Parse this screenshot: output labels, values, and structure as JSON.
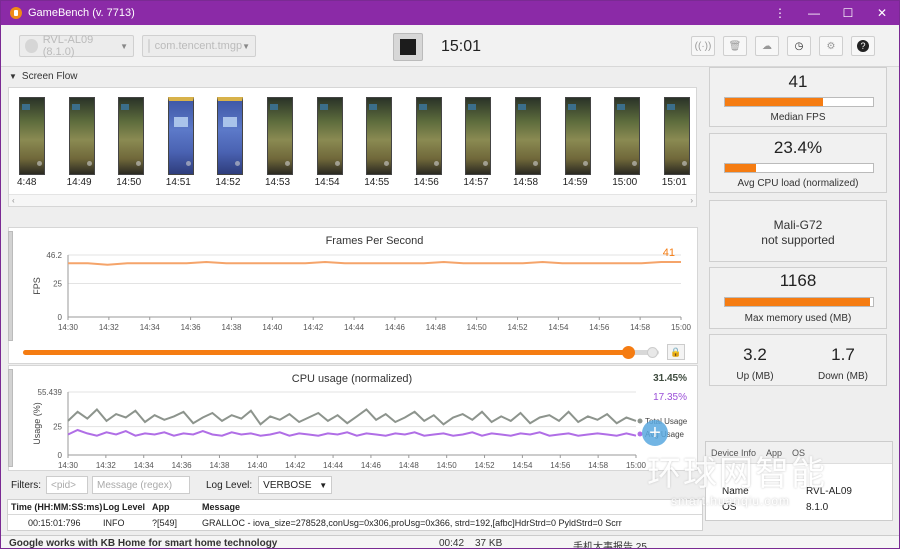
{
  "window": {
    "title": "GameBench (v. 7713)"
  },
  "toolbar": {
    "device_placeholder": "RVL-AL09 (8.1.0)",
    "app_placeholder": "com.tencent.tmgp",
    "timer": "15:01"
  },
  "screen_flow": {
    "header": "Screen Flow",
    "thumbnails": [
      {
        "time": "4:48",
        "kind": "game"
      },
      {
        "time": "14:49",
        "kind": "game"
      },
      {
        "time": "14:50",
        "kind": "game"
      },
      {
        "time": "14:51",
        "kind": "map"
      },
      {
        "time": "14:52",
        "kind": "map"
      },
      {
        "time": "14:53",
        "kind": "game"
      },
      {
        "time": "14:54",
        "kind": "game"
      },
      {
        "time": "14:55",
        "kind": "game"
      },
      {
        "time": "14:56",
        "kind": "game"
      },
      {
        "time": "14:57",
        "kind": "game"
      },
      {
        "time": "14:58",
        "kind": "game"
      },
      {
        "time": "14:59",
        "kind": "game"
      },
      {
        "time": "15:00",
        "kind": "game"
      },
      {
        "time": "15:01",
        "kind": "game"
      }
    ]
  },
  "chart_data": [
    {
      "type": "line",
      "title": "Frames Per Second",
      "ylabel": "FPS",
      "ylim": [
        0,
        46.2
      ],
      "yticks": [
        "46.2",
        "25",
        "0"
      ],
      "yticks_values": [
        46.2,
        25,
        0
      ],
      "x_ticks": [
        "14:30",
        "14:32",
        "14:34",
        "14:36",
        "14:38",
        "14:40",
        "14:42",
        "14:44",
        "14:46",
        "14:48",
        "14:50",
        "14:52",
        "14:54",
        "14:56",
        "14:58",
        "15:00"
      ],
      "current_label": "41",
      "series": [
        {
          "color": "#f5a46a",
          "values": [
            40,
            40,
            39,
            40,
            40,
            40,
            40,
            41,
            40,
            40,
            40,
            40,
            40,
            41,
            40,
            40,
            40,
            40,
            40,
            41,
            40,
            40,
            40,
            40,
            41,
            40,
            40,
            40,
            40,
            40,
            41,
            41
          ]
        }
      ]
    },
    {
      "type": "line",
      "title": "CPU usage (normalized)",
      "ylabel": "Usage (%)",
      "ylim": [
        0,
        55.439
      ],
      "yticks": [
        "55.439",
        "25",
        "0"
      ],
      "yticks_values": [
        55.439,
        25,
        0
      ],
      "x_ticks": [
        "14:30",
        "14:32",
        "14:34",
        "14:36",
        "14:38",
        "14:40",
        "14:42",
        "14:44",
        "14:46",
        "14:48",
        "14:50",
        "14:52",
        "14:54",
        "14:56",
        "14:58",
        "15:00"
      ],
      "current_values": [
        "31.45%",
        "17.35%"
      ],
      "legend": [
        "Total Usage",
        "Avg Usage"
      ],
      "series": [
        {
          "name": "Total Usage",
          "color": "#8d948d",
          "values": [
            30,
            38,
            32,
            40,
            30,
            36,
            33,
            39,
            29,
            35,
            31,
            34,
            38,
            28,
            33,
            37,
            30,
            35,
            32,
            39,
            27,
            34,
            31,
            36,
            29,
            33,
            37,
            30,
            35,
            28,
            34,
            40,
            31,
            36,
            29,
            33,
            38,
            30,
            35,
            27,
            33,
            36,
            31,
            38,
            29,
            34,
            30,
            37,
            28,
            33,
            35,
            30,
            38,
            29,
            34,
            31,
            36,
            28,
            33,
            30
          ]
        },
        {
          "name": "Avg Usage",
          "color": "#b06ee6",
          "values": [
            18,
            22,
            19,
            17,
            20,
            18,
            21,
            17,
            19,
            18,
            20,
            17,
            19,
            18,
            21,
            18,
            17,
            20,
            18,
            19,
            17,
            18,
            20,
            17,
            19,
            18,
            17,
            19,
            18,
            20,
            17,
            19,
            18,
            17,
            19,
            18,
            20,
            17,
            18,
            19,
            17,
            18,
            20,
            17,
            19,
            18,
            17,
            19,
            18,
            20,
            17,
            18,
            19,
            17,
            18,
            19,
            18,
            17,
            19,
            17
          ]
        }
      ]
    }
  ],
  "stats": {
    "fps": {
      "value": "41",
      "fraction": 0.66,
      "caption": "Median FPS"
    },
    "cpu": {
      "value": "23.4%",
      "fraction": 0.21,
      "caption": "Avg CPU load (normalized)"
    },
    "gpu": {
      "line1": "Mali-G72",
      "line2": "not supported"
    },
    "memory": {
      "value": "1168",
      "fraction": 0.98,
      "caption": "Max memory used (MB)"
    },
    "network": {
      "up_value": "3.2",
      "up_label": "Up (MB)",
      "down_value": "1.7",
      "down_label": "Down (MB)"
    }
  },
  "filters": {
    "label": "Filters:",
    "pid_placeholder": "<pid>",
    "msg_placeholder": "Message (regex)",
    "loglevel_label": "Log Level:",
    "loglevel_value": "VERBOSE"
  },
  "log": {
    "headers": [
      "Time (HH:MM:SS:ms)",
      "Log Level",
      "App",
      "Message"
    ],
    "rows": [
      {
        "time": "00:15:01:796",
        "level": "INFO",
        "app": "?[549]",
        "message": "GRALLOC -      iova_size=278528,conUsg=0x306,proUsg=0x366,        strd=192,[afbc]HdrStrd=0 PyldStrd=0 Scrr"
      }
    ]
  },
  "device": {
    "tabs": [
      "Device Info",
      "App",
      "OS"
    ],
    "rows": [
      {
        "label": "Name",
        "value": "RVL-AL09"
      },
      {
        "label": "OS",
        "value": "8.1.0"
      }
    ]
  },
  "watermark": {
    "big": "环球网智能",
    "small": "smart.huanqiu.com"
  },
  "background_text": {
    "headline": "Google works with KB Home for smart home technology",
    "time": "00:42",
    "size": "37 KB",
    "other": "手机大事报告 25"
  },
  "colors": {
    "accent": "#f57c12",
    "titlebar": "#8b2aa7",
    "fps_line": "#f5a46a",
    "cpu_total": "#8d948d",
    "cpu_avg": "#b06ee6"
  }
}
